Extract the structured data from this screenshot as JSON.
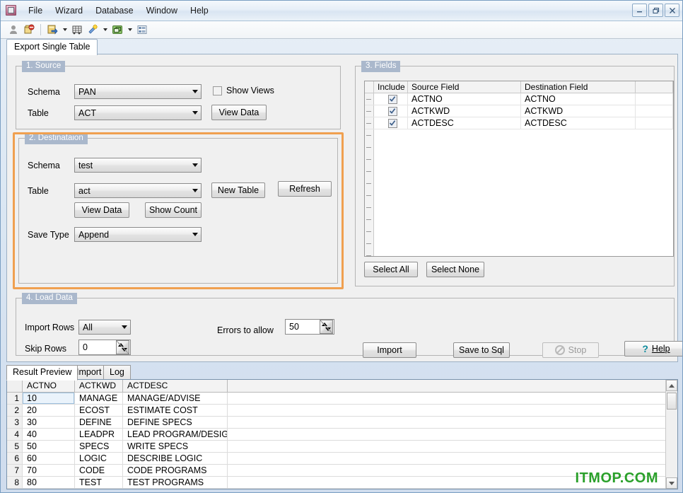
{
  "window": {
    "app_icon": "app-icon",
    "menu": [
      "File",
      "Wizard",
      "Database",
      "Window",
      "Help"
    ],
    "controls": {
      "minimize": "minimize-button",
      "restore": "restore-button",
      "close": "close-button"
    }
  },
  "toolbar": {
    "items": [
      {
        "name": "user-icon",
        "label": ""
      },
      {
        "name": "disconnect-icon",
        "label": ""
      },
      {
        "name": "export-database-icon",
        "label": ""
      },
      {
        "name": "grid-table-icon",
        "label": ""
      },
      {
        "name": "wand-icon",
        "label": ""
      },
      {
        "name": "window-green-icon",
        "label": ""
      },
      {
        "name": "list-details-icon",
        "label": ""
      }
    ]
  },
  "tabs": {
    "main": [
      "Export Single Table"
    ],
    "active": "Export Single Table"
  },
  "source": {
    "title": "1. Source",
    "schema_label": "Schema",
    "schema_value": "PAN",
    "table_label": "Table",
    "table_value": "ACT",
    "show_views_label": "Show Views",
    "show_views_checked": false,
    "view_data_label": "View Data"
  },
  "destination": {
    "title": "2. Destinataion",
    "highlight_color": "#f0a050",
    "schema_label": "Schema",
    "schema_value": "test",
    "table_label": "Table",
    "table_value": "act",
    "new_table_label": "New Table",
    "refresh_label": "Refresh",
    "view_data_label": "View Data",
    "show_count_label": "Show Count",
    "save_type_label": "Save Type",
    "save_type_value": "Append"
  },
  "fields": {
    "title": "3. Fields",
    "columns": [
      "Include",
      "Source Field",
      "Destination Field",
      ""
    ],
    "rows": [
      {
        "include": true,
        "source": "ACTNO",
        "destination": "ACTNO"
      },
      {
        "include": true,
        "source": "ACTKWD",
        "destination": "ACTKWD"
      },
      {
        "include": true,
        "source": "ACTDESC",
        "destination": "ACTDESC"
      }
    ],
    "select_all_label": "Select All",
    "select_none_label": "Select None"
  },
  "load_data": {
    "title": "4. Load Data",
    "import_rows_label": "Import Rows",
    "import_rows_value": "All",
    "skip_rows_label": "Skip Rows",
    "skip_rows_value": "0",
    "errors_to_allow_label": "Errors to allow",
    "errors_to_allow_value": "50",
    "import_label": "Import",
    "save_to_sql_label": "Save to Sql",
    "stop_label": "Stop",
    "stop_disabled": true,
    "help_label": "Help"
  },
  "bottom": {
    "tabs": [
      "Result Preview",
      "Import",
      "Log"
    ],
    "active_tab": "Result Preview",
    "grid": {
      "columns": [
        "ACTNO",
        "ACTKWD",
        "ACTDESC"
      ],
      "rows": [
        {
          "n": "1",
          "ACTNO": "10",
          "ACTKWD": "MANAGE",
          "ACTDESC": "MANAGE/ADVISE"
        },
        {
          "n": "2",
          "ACTNO": "20",
          "ACTKWD": "ECOST",
          "ACTDESC": "ESTIMATE COST"
        },
        {
          "n": "3",
          "ACTNO": "30",
          "ACTKWD": "DEFINE",
          "ACTDESC": "DEFINE SPECS"
        },
        {
          "n": "4",
          "ACTNO": "40",
          "ACTKWD": "LEADPR",
          "ACTDESC": "LEAD PROGRAM/DESIGN"
        },
        {
          "n": "5",
          "ACTNO": "50",
          "ACTKWD": "SPECS",
          "ACTDESC": "WRITE SPECS"
        },
        {
          "n": "6",
          "ACTNO": "60",
          "ACTKWD": "LOGIC",
          "ACTDESC": "DESCRIBE LOGIC"
        },
        {
          "n": "7",
          "ACTNO": "70",
          "ACTKWD": "CODE",
          "ACTDESC": "CODE PROGRAMS"
        },
        {
          "n": "8",
          "ACTNO": "80",
          "ACTKWD": "TEST",
          "ACTDESC": "TEST PROGRAMS"
        }
      ],
      "selected_cell": "10"
    }
  },
  "watermark": {
    "text": "ITMOP.COM",
    "color": "#2aa02a"
  }
}
